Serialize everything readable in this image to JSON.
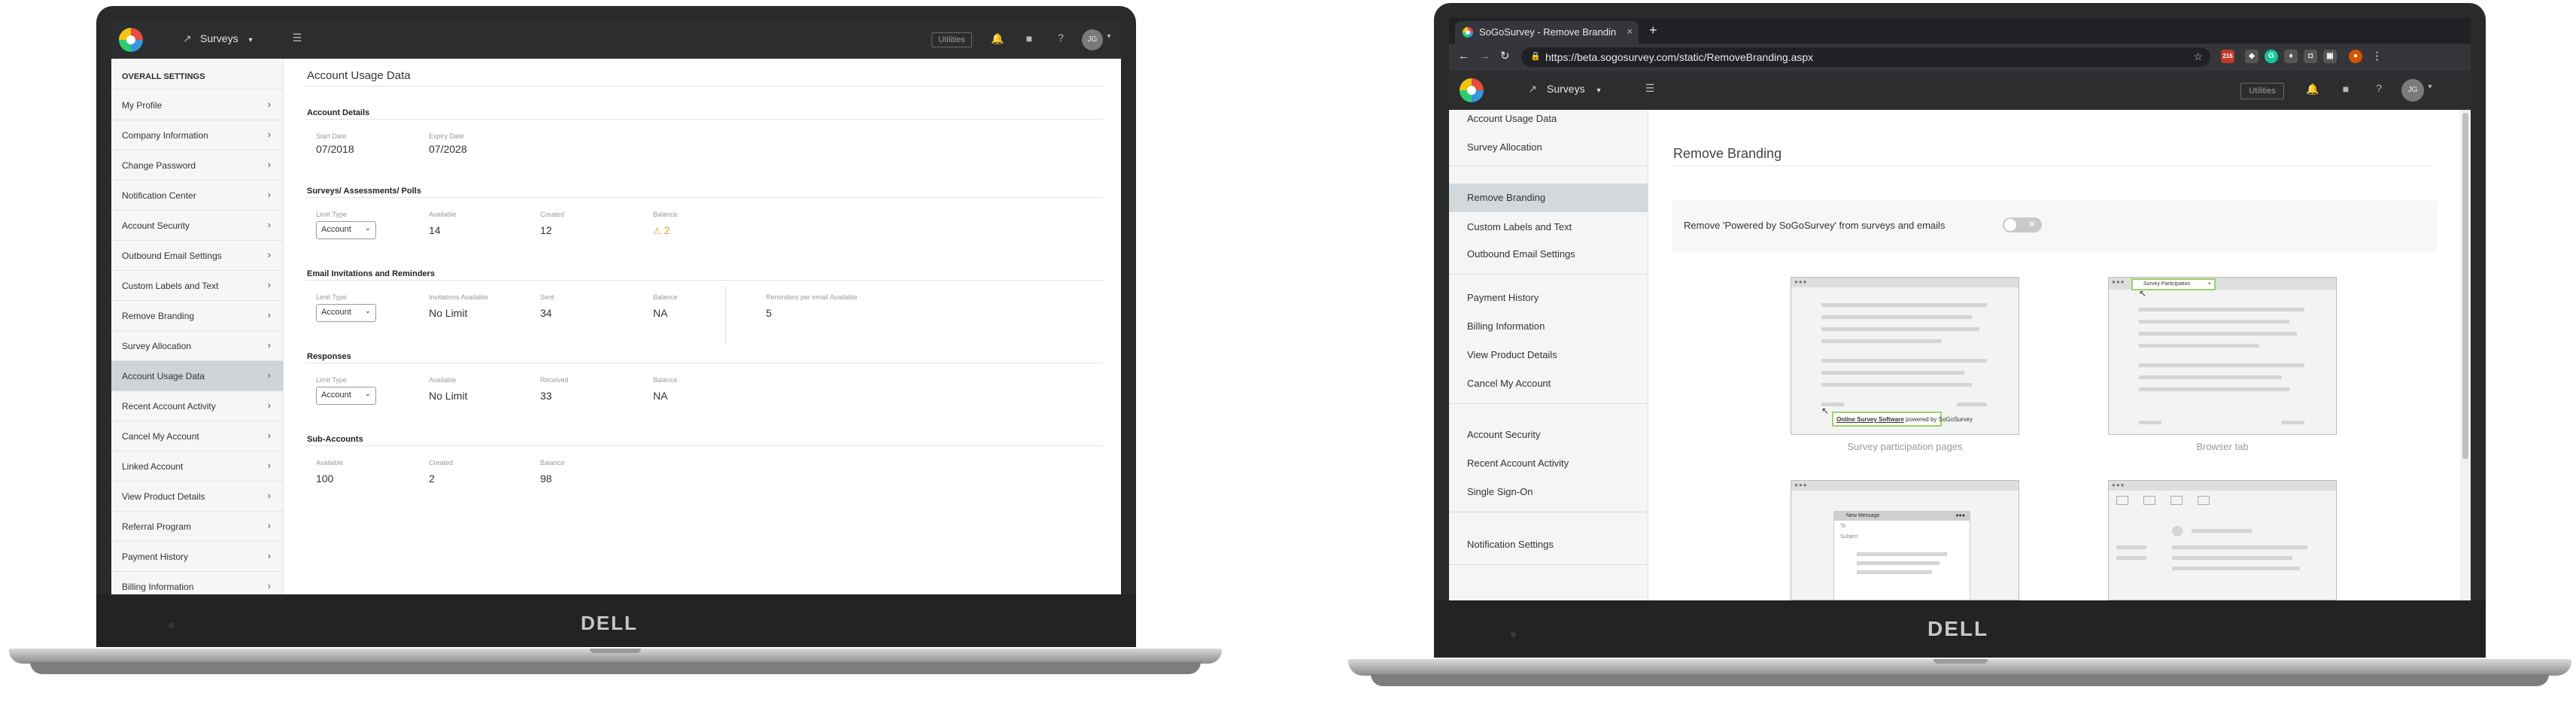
{
  "left_app": {
    "topbar": {
      "product_label": "Surveys",
      "utilities_label": "Utilities",
      "avatar_initials": "JG"
    },
    "sidebar": {
      "heading": "OVERALL SETTINGS",
      "items": [
        {
          "label": "My Profile"
        },
        {
          "label": "Company Information"
        },
        {
          "label": "Change Password"
        },
        {
          "label": "Notification Center"
        },
        {
          "label": "Account Security"
        },
        {
          "label": "Outbound Email Settings"
        },
        {
          "label": "Custom Labels and Text"
        },
        {
          "label": "Remove Branding"
        },
        {
          "label": "Survey Allocation"
        },
        {
          "label": "Account Usage Data",
          "active": true
        },
        {
          "label": "Recent Account Activity"
        },
        {
          "label": "Cancel My Account"
        },
        {
          "label": "Linked Account"
        },
        {
          "label": "View Product Details"
        },
        {
          "label": "Referral Program"
        },
        {
          "label": "Payment History"
        },
        {
          "label": "Billing Information"
        }
      ]
    },
    "main": {
      "title": "Account Usage Data",
      "account_details": {
        "title": "Account Details",
        "start_label": "Start Date",
        "start_value": "07/2018",
        "expiry_label": "Expiry Date",
        "expiry_value": "07/2028"
      },
      "surveys": {
        "title": "Surveys/ Assessments/ Polls",
        "limit_label": "Limit Type",
        "limit_value": "Account",
        "available_label": "Available",
        "available_value": "14",
        "created_label": "Created",
        "created_value": "12",
        "balance_label": "Balance",
        "balance_value": "2"
      },
      "email": {
        "title": "Email Invitations and Reminders",
        "limit_label": "Limit Type",
        "limit_value": "Account",
        "inv_label": "Invitations Available",
        "inv_value": "No Limit",
        "sent_label": "Sent",
        "sent_value": "34",
        "balance_label": "Balance",
        "balance_value": "NA",
        "rem_label": "Reminders per email Available",
        "rem_value": "5"
      },
      "responses": {
        "title": "Responses",
        "limit_label": "Limit Type",
        "limit_value": "Account",
        "available_label": "Available",
        "available_value": "No Limit",
        "received_label": "Received",
        "received_value": "33",
        "balance_label": "Balance",
        "balance_value": "NA"
      },
      "subaccounts": {
        "title": "Sub-Accounts",
        "available_label": "Available",
        "available_value": "100",
        "created_label": "Created",
        "created_value": "2",
        "balance_label": "Balance",
        "balance_value": "98"
      }
    }
  },
  "right_app": {
    "browser": {
      "tab_title": "SoGoSurvey - Remove Brandin",
      "url": "https://beta.sogosurvey.com/static/RemoveBranding.aspx",
      "ext_badge": "216"
    },
    "topbar": {
      "product_label": "Surveys",
      "utilities_label": "Utilities",
      "avatar_initials": "JG"
    },
    "sidebar": {
      "items_a": [
        "Account Usage Data",
        "Survey Allocation"
      ],
      "active": "Remove Branding",
      "items_b": [
        "Custom Labels and Text",
        "Outbound Email Settings"
      ],
      "items_c": [
        "Payment History",
        "Billing Information",
        "View Product Details",
        "Cancel My Account"
      ],
      "items_d": [
        "Account Security",
        "Recent Account Activity",
        "Single Sign-On"
      ],
      "items_e": [
        "Notification Settings"
      ]
    },
    "main": {
      "title": "Remove Branding",
      "toggle_label": "Remove 'Powered by SoGoSurvey' from surveys and emails",
      "toggle_state": "off",
      "preview1_caption": "Survey participation pages",
      "preview1_link": "Online Survey Software",
      "preview1_suffix": " powered by SoGoSurvey",
      "preview2_caption": "Browser tab",
      "preview2_tab": "Survey Participation",
      "preview3_header": "New Message",
      "preview3_to": "To",
      "preview3_subject": "Subject"
    }
  },
  "brand": "DELL",
  "colors": {
    "topbar": "#2b2d2f",
    "active_item": "#cfd4d9",
    "warning": "#e69b1c"
  }
}
